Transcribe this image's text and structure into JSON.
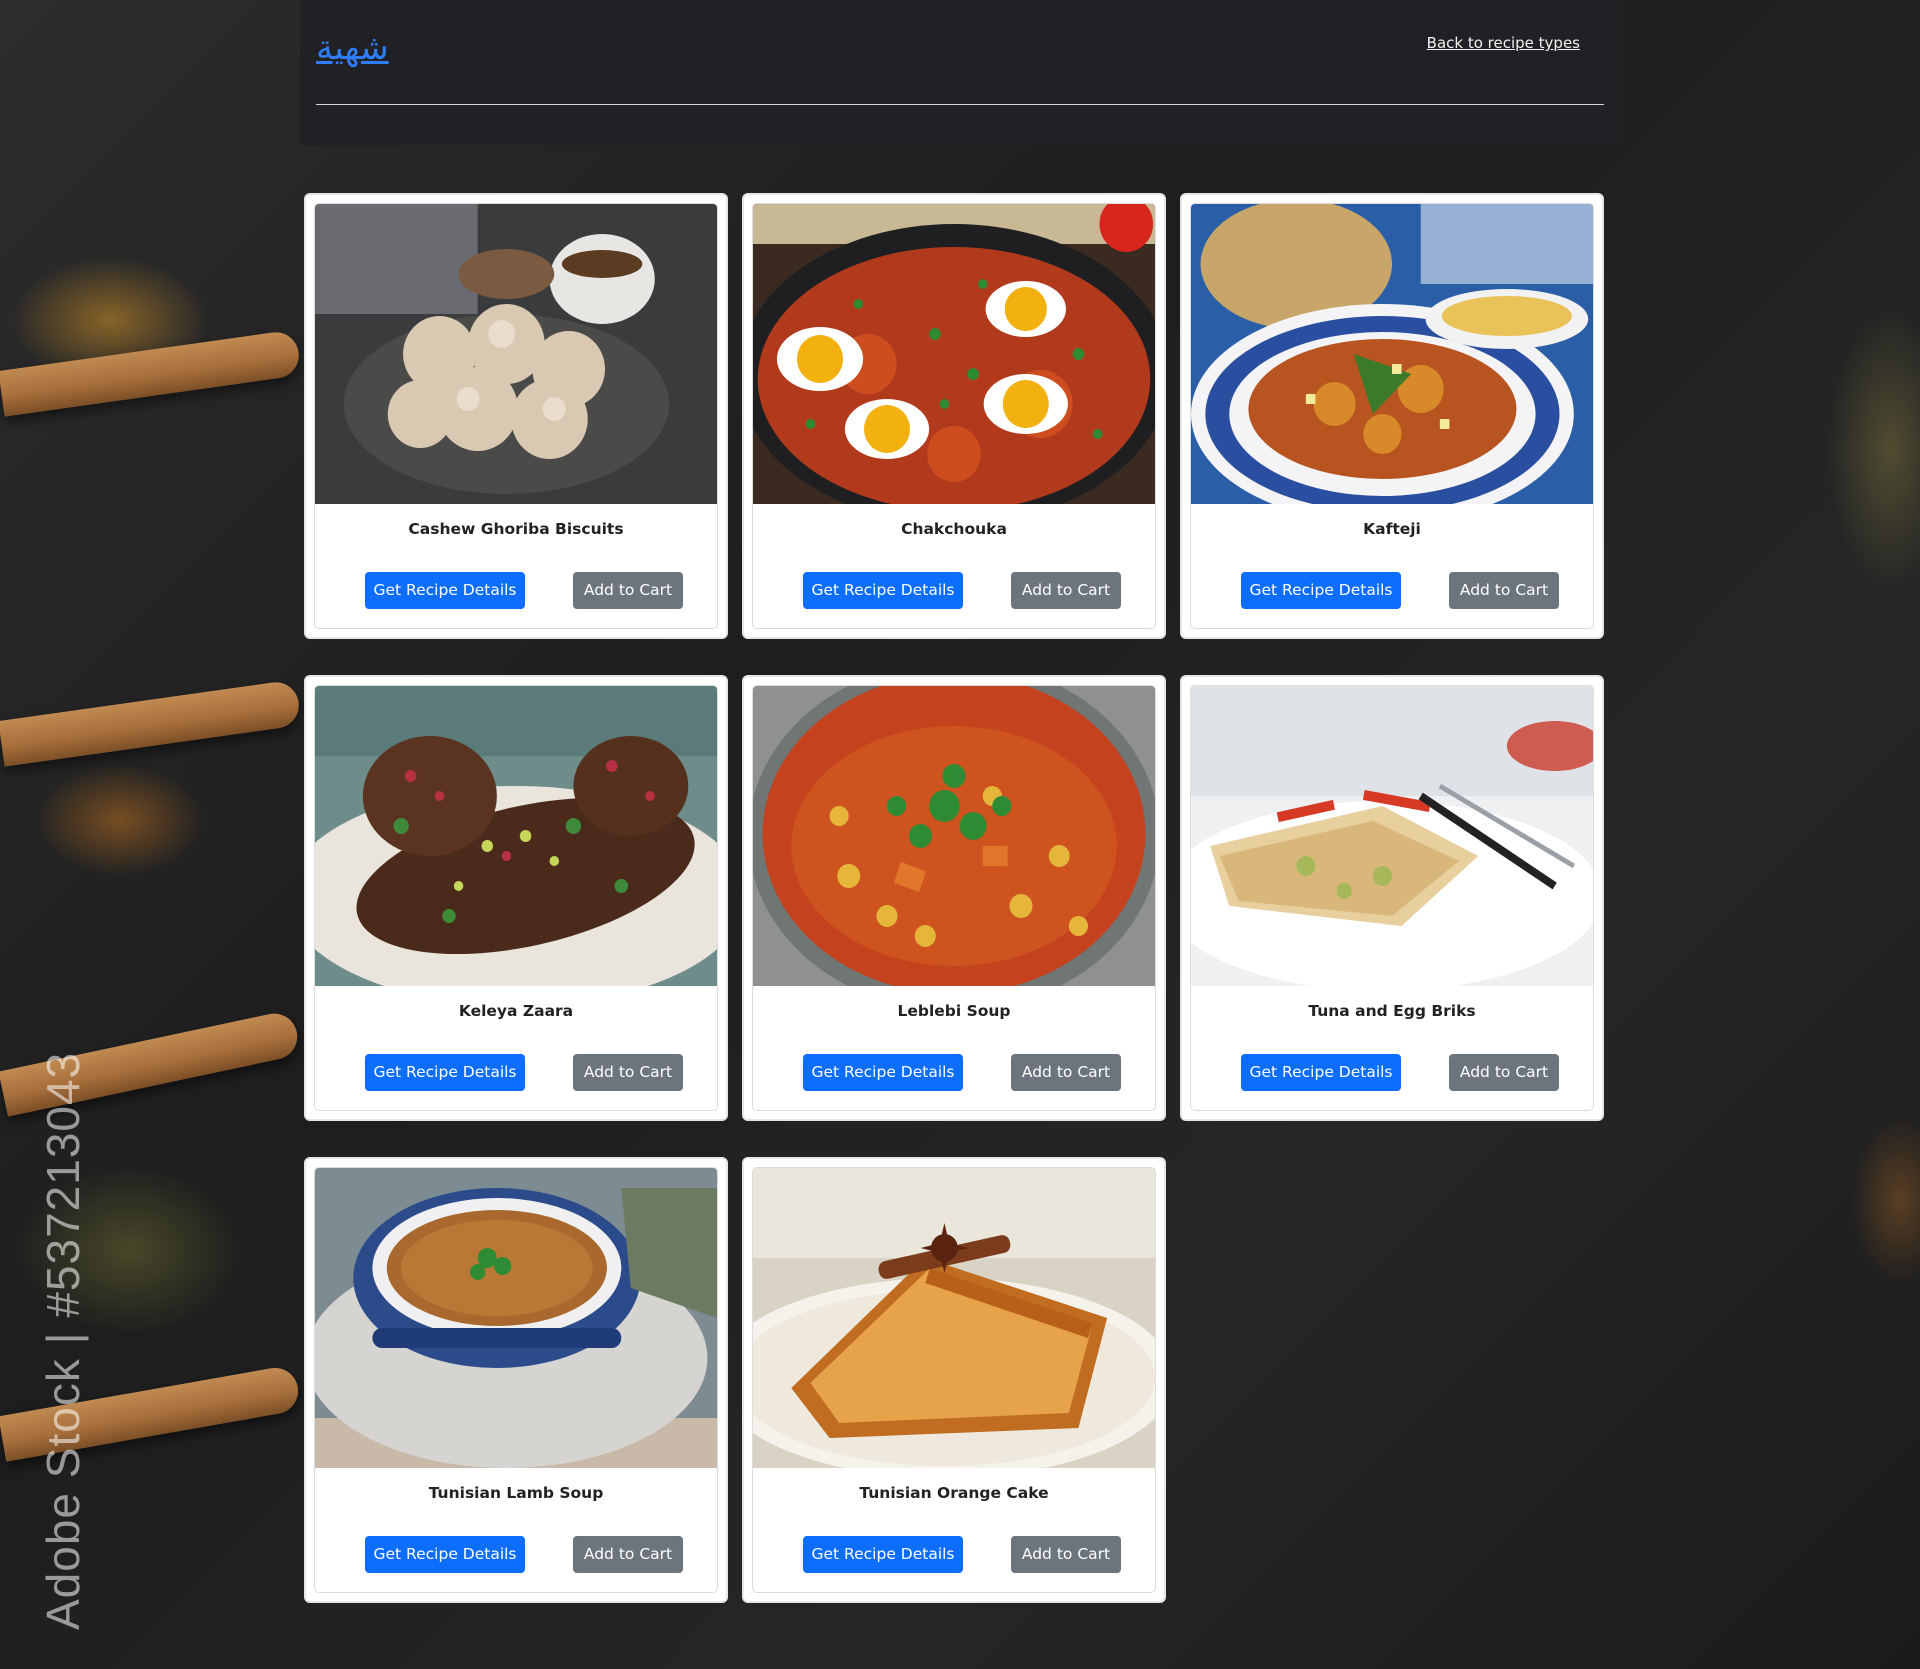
{
  "header": {
    "brand": "شهية",
    "back_link": "Back to recipe types"
  },
  "watermark": "Adobe Stock | #537213043",
  "recipes": [
    {
      "name": "Cashew Ghoriba Biscuits",
      "details_label": "Get Recipe Details",
      "cart_label": "Add to Cart",
      "image": "cashew-ghoriba-biscuits-photo"
    },
    {
      "name": "Chakchouka",
      "details_label": "Get Recipe Details",
      "cart_label": "Add to Cart",
      "image": "chakchouka-photo"
    },
    {
      "name": "Kafteji",
      "details_label": "Get Recipe Details",
      "cart_label": "Add to Cart",
      "image": "kafteji-photo"
    },
    {
      "name": "Keleya Zaara",
      "details_label": "Get Recipe Details",
      "cart_label": "Add to Cart",
      "image": "keleya-zaara-photo"
    },
    {
      "name": "Leblebi Soup",
      "details_label": "Get Recipe Details",
      "cart_label": "Add to Cart",
      "image": "leblebi-soup-photo"
    },
    {
      "name": "Tuna and Egg Briks",
      "details_label": "Get Recipe Details",
      "cart_label": "Add to Cart",
      "image": "tuna-and-egg-briks-photo"
    },
    {
      "name": "Tunisian Lamb Soup",
      "details_label": "Get Recipe Details",
      "cart_label": "Add to Cart",
      "image": "tunisian-lamb-soup-photo"
    },
    {
      "name": "Tunisian Orange Cake",
      "details_label": "Get Recipe Details",
      "cart_label": "Add to Cart",
      "image": "tunisian-orange-cake-photo"
    }
  ],
  "colors": {
    "header_bg": "#202124",
    "brand_link": "#2f7dfd",
    "primary_button": "#0d6efd",
    "secondary_button": "#6c757d",
    "card_bg": "#ffffff"
  }
}
